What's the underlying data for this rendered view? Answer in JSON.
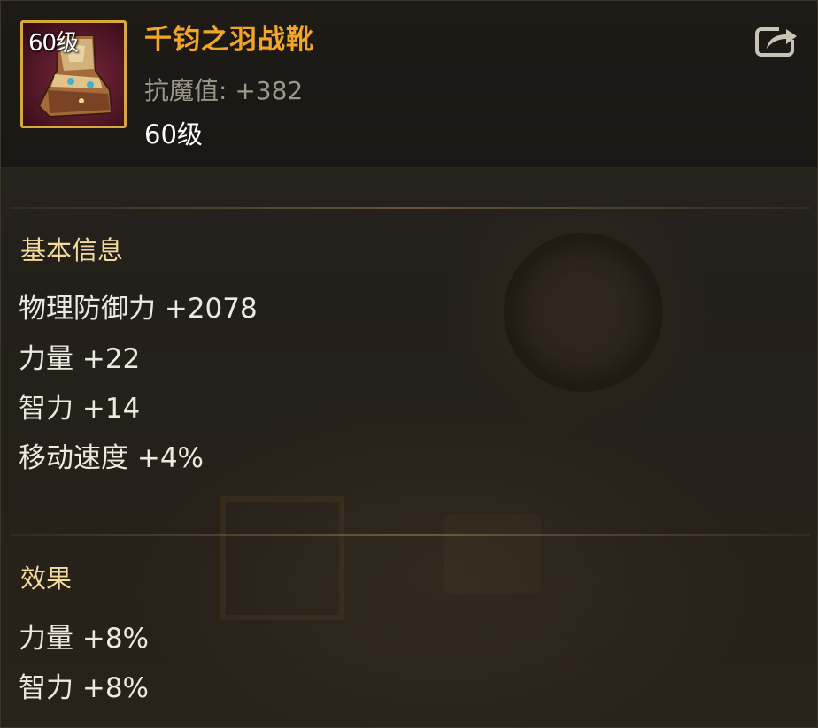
{
  "item": {
    "icon_level": "60级",
    "name": "千钧之羽战靴",
    "magic_resist": "抗魔值: +382",
    "level": "60级",
    "icon": "boot-icon"
  },
  "header": {
    "share_icon": "share-icon"
  },
  "basic_info": {
    "title": "基本信息",
    "stats": [
      "物理防御力 +2078",
      "力量 +22",
      "智力 +14",
      "移动速度 +4%"
    ]
  },
  "effects": {
    "title": "效果",
    "stats": [
      "力量 +8%",
      "智力 +8%"
    ]
  },
  "colors": {
    "item_name": "#f2a623",
    "section_title": "#f3dc9b",
    "frame": "#d8a93a"
  }
}
